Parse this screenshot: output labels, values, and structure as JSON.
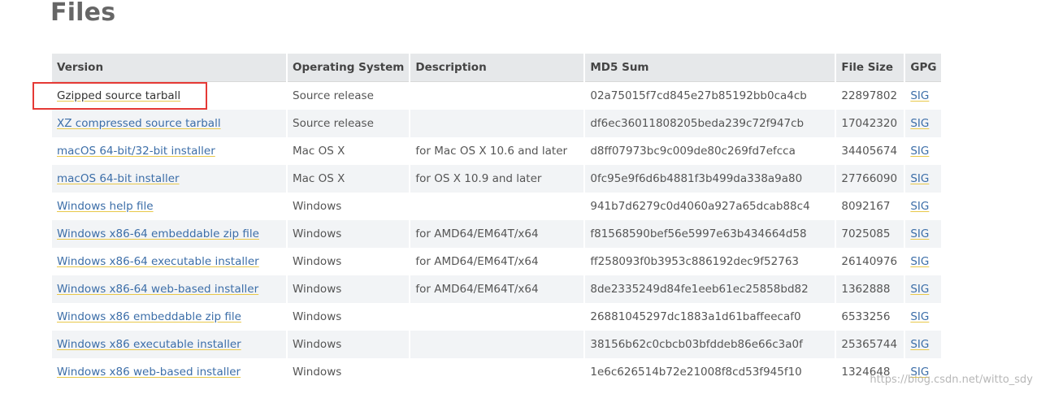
{
  "page": {
    "title": "Files"
  },
  "table": {
    "headers": {
      "version": "Version",
      "os": "Operating System",
      "description": "Description",
      "md5": "MD5 Sum",
      "size": "File Size",
      "gpg": "GPG"
    },
    "rows": [
      {
        "version": "Gzipped source tarball",
        "os": "Source release",
        "description": "",
        "md5": "02a75015f7cd845e27b85192bb0ca4cb",
        "size": "22897802",
        "gpg": "SIG"
      },
      {
        "version": "XZ compressed source tarball",
        "os": "Source release",
        "description": "",
        "md5": "df6ec36011808205beda239c72f947cb",
        "size": "17042320",
        "gpg": "SIG"
      },
      {
        "version": "macOS 64-bit/32-bit installer",
        "os": "Mac OS X",
        "description": "for Mac OS X 10.6 and later",
        "md5": "d8ff07973bc9c009de80c269fd7efcca",
        "size": "34405674",
        "gpg": "SIG"
      },
      {
        "version": "macOS 64-bit installer",
        "os": "Mac OS X",
        "description": "for OS X 10.9 and later",
        "md5": "0fc95e9f6d6b4881f3b499da338a9a80",
        "size": "27766090",
        "gpg": "SIG"
      },
      {
        "version": "Windows help file",
        "os": "Windows",
        "description": "",
        "md5": "941b7d6279c0d4060a927a65dcab88c4",
        "size": "8092167",
        "gpg": "SIG"
      },
      {
        "version": "Windows x86-64 embeddable zip file",
        "os": "Windows",
        "description": "for AMD64/EM64T/x64",
        "md5": "f81568590bef56e5997e63b434664d58",
        "size": "7025085",
        "gpg": "SIG"
      },
      {
        "version": "Windows x86-64 executable installer",
        "os": "Windows",
        "description": "for AMD64/EM64T/x64",
        "md5": "ff258093f0b3953c886192dec9f52763",
        "size": "26140976",
        "gpg": "SIG"
      },
      {
        "version": "Windows x86-64 web-based installer",
        "os": "Windows",
        "description": "for AMD64/EM64T/x64",
        "md5": "8de2335249d84fe1eeb61ec25858bd82",
        "size": "1362888",
        "gpg": "SIG"
      },
      {
        "version": "Windows x86 embeddable zip file",
        "os": "Windows",
        "description": "",
        "md5": "26881045297dc1883a1d61baffeecaf0",
        "size": "6533256",
        "gpg": "SIG"
      },
      {
        "version": "Windows x86 executable installer",
        "os": "Windows",
        "description": "",
        "md5": "38156b62c0cbcb03bfddeb86e66c3a0f",
        "size": "25365744",
        "gpg": "SIG"
      },
      {
        "version": "Windows x86 web-based installer",
        "os": "Windows",
        "description": "",
        "md5": "1e6c626514b72e21008f8cd53f945f10",
        "size": "1324648",
        "gpg": "SIG"
      }
    ]
  },
  "watermark": "https://blog.csdn.net/witto_sdy",
  "colors": {
    "link": "#3c6ea8",
    "highlight": "#e53935",
    "header_bg": "#e6e8ea"
  }
}
